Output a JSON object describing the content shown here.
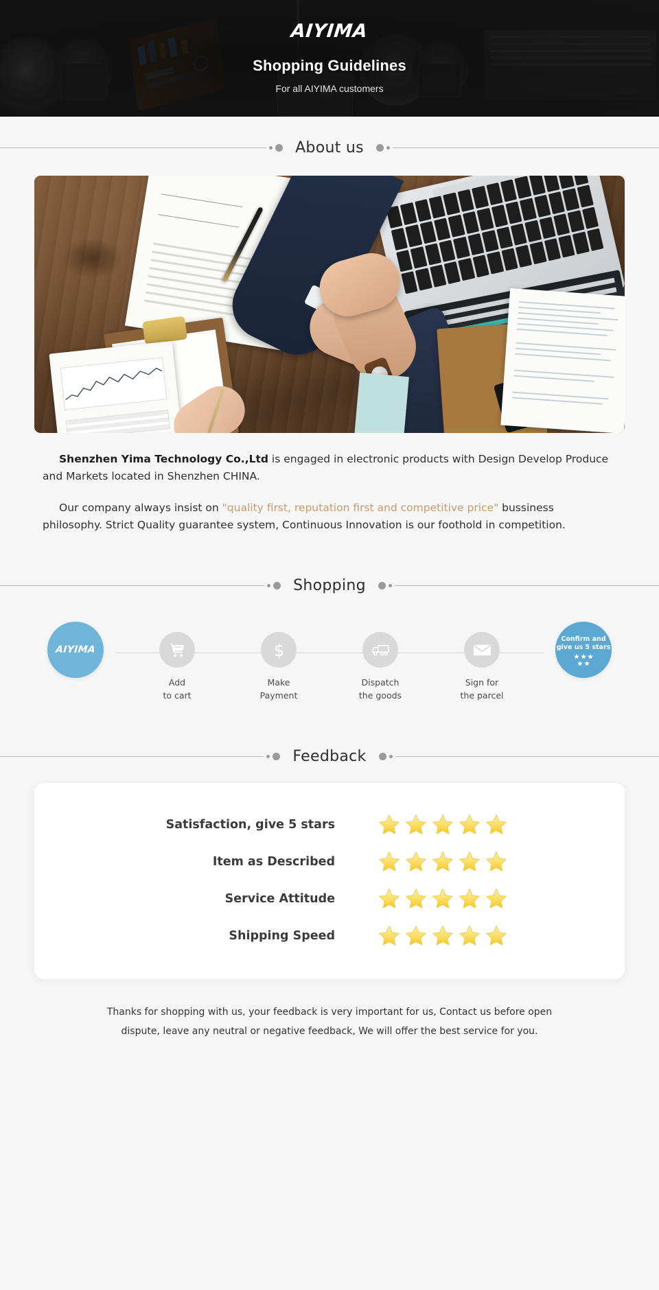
{
  "banner": {
    "logo": "AIYIMA",
    "title": "Shopping Guidelines",
    "subtitle": "For all AIYIMA customers"
  },
  "sections": {
    "about_title": "About us",
    "shopping_title": "Shopping",
    "feedback_title": "Feedback"
  },
  "about": {
    "p1_company": "Shenzhen Yima Technology Co.,Ltd",
    "p1_rest": " is engaged in electronic products with Design Develop Produce and Markets located in Shenzhen CHINA.",
    "p2_pre": "Our company always insist on ",
    "p2_quote": "\"quality first, reputation first and competitive price\"",
    "p2_post": " bussiness philosophy. Strict Quality guarantee system, Continuous Innovation is our foothold in competition."
  },
  "shopping_steps": [
    {
      "icon": "aiyima-logo-icon",
      "logo": "AIYIMA",
      "label_line1": "",
      "label_line2": ""
    },
    {
      "icon": "shopping-cart-icon",
      "label_line1": "Add",
      "label_line2": "to cart"
    },
    {
      "icon": "dollar-icon",
      "label_line1": "Make",
      "label_line2": "Payment"
    },
    {
      "icon": "delivery-truck-icon",
      "label_line1": "Dispatch",
      "label_line2": "the goods"
    },
    {
      "icon": "envelope-icon",
      "label_line1": "Sign for",
      "label_line2": "the parcel"
    },
    {
      "icon": "five-stars-icon",
      "badge_line1": "Confirm and",
      "badge_line2": "give us 5 stars",
      "stars": 5
    }
  ],
  "feedback_rows": [
    {
      "label": "Satisfaction, give 5 stars",
      "stars": 5
    },
    {
      "label": "Item as Described",
      "stars": 5
    },
    {
      "label": "Service Attitude",
      "stars": 5
    },
    {
      "label": "Shipping Speed",
      "stars": 5
    }
  ],
  "footer": {
    "line1": "Thanks for shopping with us, your feedback is very important for us, Contact us before open",
    "line2": "dispute, leave any neutral or negative feedback, We will offer the best service for you."
  },
  "colors": {
    "banner_bg": "#161616",
    "page_bg": "#f6f6f6",
    "accent_blue": "#6fb5da",
    "accent_blue_dark": "#5ba9d2",
    "step_gray": "#d9d9d9",
    "quote_text": "#c79a6f",
    "star_gold": "#f7d547"
  }
}
